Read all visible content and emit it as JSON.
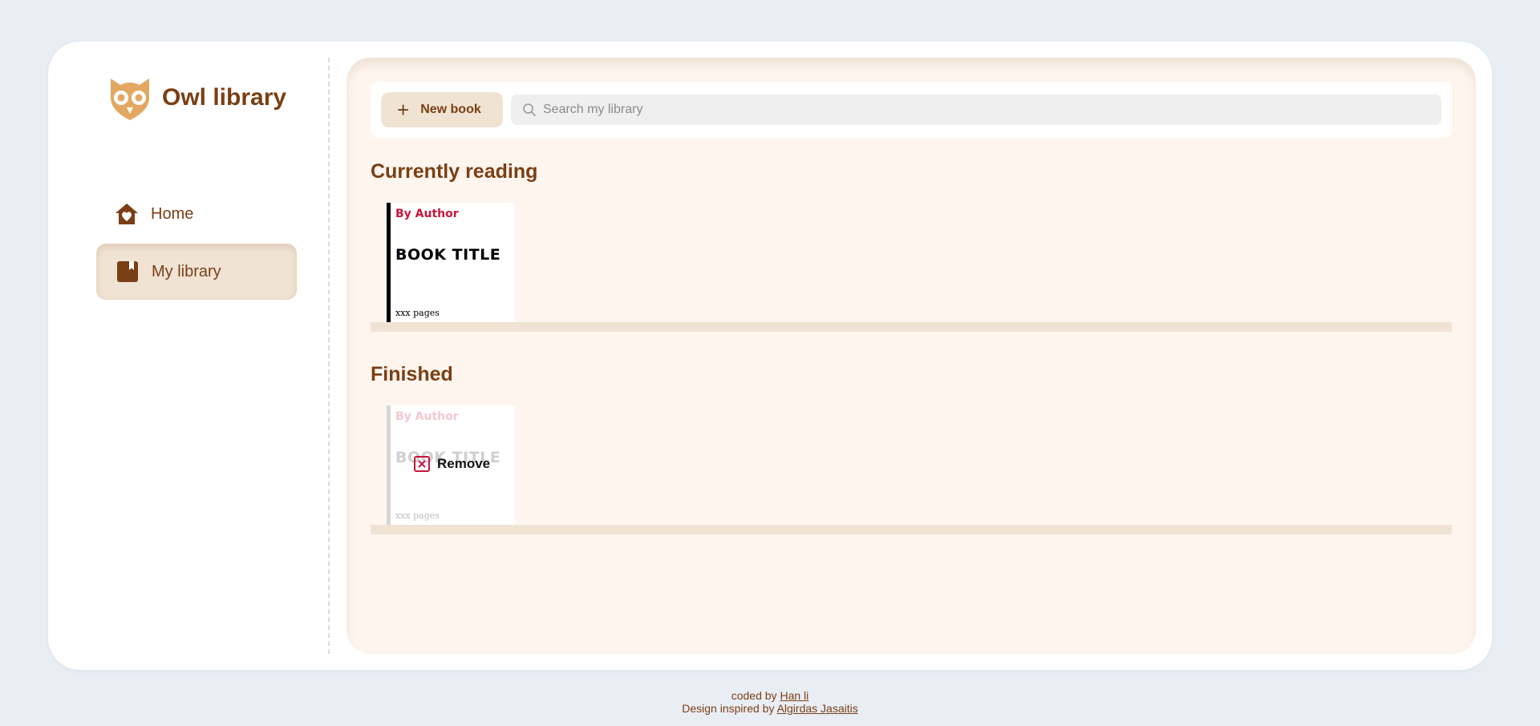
{
  "app": {
    "name": "Owl library"
  },
  "sidebar": {
    "items": [
      {
        "label": "Home",
        "icon": "home-heart-icon",
        "active": false
      },
      {
        "label": "My library",
        "icon": "bookmark-book-icon",
        "active": true
      }
    ]
  },
  "toolbar": {
    "new_book_label": "New book",
    "search_placeholder": "Search my library"
  },
  "sections": [
    {
      "title": "Currently reading",
      "books": [
        {
          "author": "By Author",
          "title": "BOOK TITLE",
          "pages": "xxx pages"
        }
      ]
    },
    {
      "title": "Finished",
      "books": [
        {
          "author": "By Author",
          "title": "BOOK TITLE",
          "pages": "xxx pages",
          "hover_action": "Remove"
        }
      ]
    }
  ],
  "footer": {
    "coded_by_prefix": "coded by",
    "coded_by_name": "Han li",
    "inspired_prefix": "Design inspired by",
    "inspired_name": "Algirdas Jasaitis"
  },
  "colors": {
    "brand_brown": "#7a3f14",
    "accent_tan": "#f0e3d4",
    "author_red": "#c8163c",
    "page_bg": "#e9edf4",
    "main_bg": "#fdf5ee"
  }
}
